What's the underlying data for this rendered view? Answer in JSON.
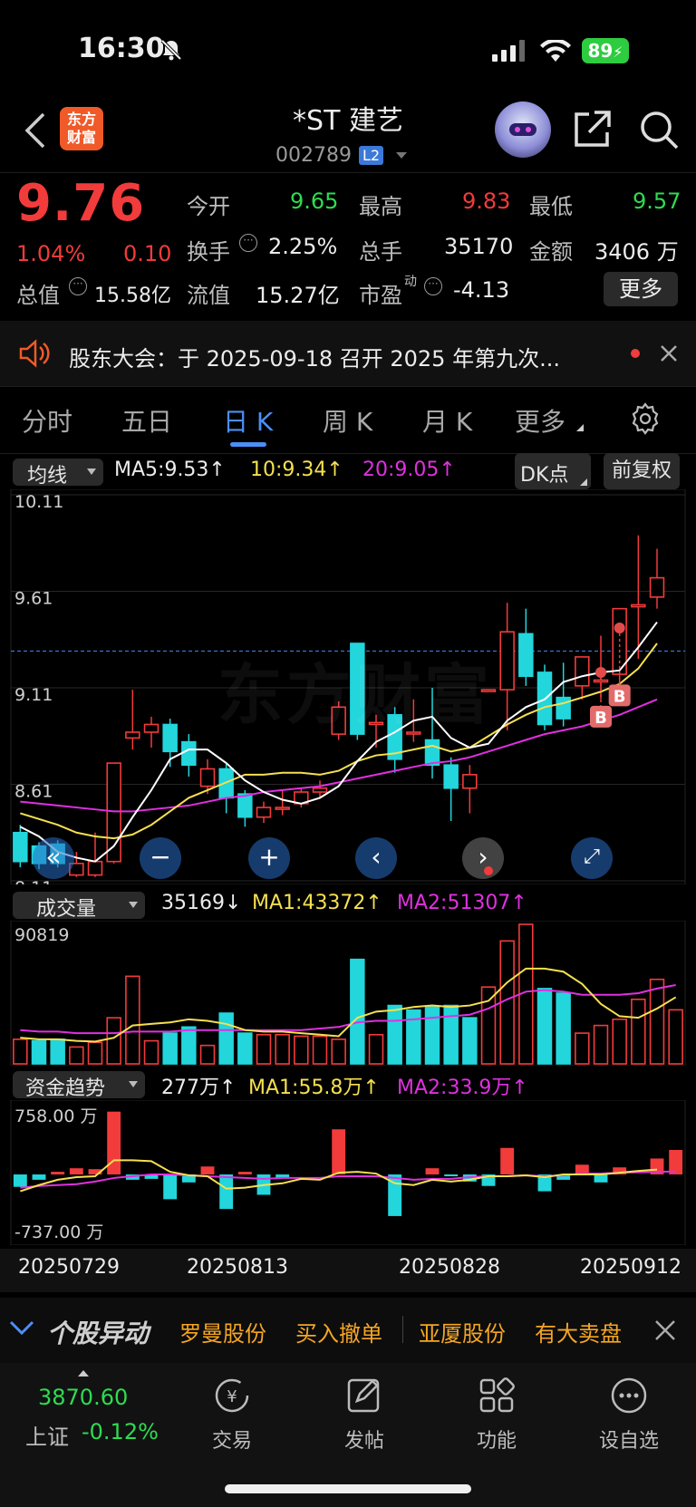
{
  "status_bar": {
    "time": "16:30",
    "battery": "89"
  },
  "header": {
    "logo_text": "东方财富",
    "stock_name": "*ST 建艺",
    "stock_code": "002789",
    "level_badge": "L2"
  },
  "quote": {
    "price": "9.76",
    "change_pct": "1.04%",
    "change": "0.10",
    "open_label": "今开",
    "open": "9.65",
    "high_label": "最高",
    "high": "9.83",
    "low_label": "最低",
    "low": "9.57",
    "turnover_label": "换手",
    "turnover": "2.25%",
    "volume_label": "总手",
    "volume": "35170",
    "amount_label": "金额",
    "amount": "3406 万",
    "mktcap_label": "总值",
    "mktcap": "15.58亿",
    "float_label": "流值",
    "float_cap": "15.27亿",
    "pe_label": "市盈",
    "pe_sup": "动",
    "pe": "-4.13",
    "more_button": "更多"
  },
  "notice": {
    "text": "股东大会：于 2025-09-18 召开 2025 年第九次..."
  },
  "tabs": [
    {
      "label": "分时"
    },
    {
      "label": "五日"
    },
    {
      "label": "日 K"
    },
    {
      "label": "周 K"
    },
    {
      "label": "月 K"
    },
    {
      "label": "更多"
    }
  ],
  "ma_bar": {
    "selector": "均线",
    "ma5": "MA5:9.53↑",
    "ma10": "10:9.34↑",
    "ma20": "20:9.05↑",
    "dk_button": "DK点",
    "adjust_button": "前复权"
  },
  "price_axis": [
    "10.11",
    "9.61",
    "9.11",
    "8.61",
    "8.11"
  ],
  "volume_bar": {
    "selector": "成交量",
    "value": "35169↓",
    "ma1": "MA1:43372↑",
    "ma2": "MA2:51307↑",
    "max_label": "90819"
  },
  "fund_bar": {
    "selector": "资金趋势",
    "value": "277万↑",
    "ma1": "MA1:55.8万↑",
    "ma2": "MA2:33.9万↑",
    "max_label": "758.00 万",
    "min_label": "-737.00 万"
  },
  "dates": [
    "20250729",
    "20250813",
    "20250828",
    "20250912"
  ],
  "signal_mark": "B",
  "watermark": "东方财富",
  "ticker_bar": {
    "title": "个股异动",
    "items": [
      "罗曼股份",
      "买入撤单",
      "亚厦股份",
      "有大卖盘"
    ]
  },
  "index_info": {
    "value": "3870.60",
    "name": "上证",
    "change": "-0.12%"
  },
  "bottom_nav": [
    {
      "label": "交易"
    },
    {
      "label": "发帖"
    },
    {
      "label": "功能"
    },
    {
      "label": "设自选"
    }
  ],
  "colors": {
    "up": "#f23b3b",
    "down": "#22d6dc",
    "ma5": "#ffffff",
    "ma10": "#f5e050",
    "ma20": "#e030e0",
    "accent": "#4b8ff6"
  },
  "chart_data": {
    "type": "candlestick",
    "y_range": [
      8.11,
      10.11
    ],
    "ref_price": 9.3,
    "candles": [
      {
        "o": 8.36,
        "c": 8.21,
        "h": 8.4,
        "l": 8.18
      },
      {
        "o": 8.29,
        "c": 8.2,
        "h": 8.31,
        "l": 8.17
      },
      {
        "o": 8.3,
        "c": 8.2,
        "h": 8.32,
        "l": 8.18
      },
      {
        "o": 8.14,
        "c": 8.2,
        "h": 8.26,
        "l": 8.13
      },
      {
        "o": 8.14,
        "c": 8.21,
        "h": 8.36,
        "l": 8.13
      },
      {
        "o": 8.21,
        "c": 8.72,
        "h": 8.72,
        "l": 8.2
      },
      {
        "o": 8.85,
        "c": 8.88,
        "h": 9.1,
        "l": 8.79
      },
      {
        "o": 8.88,
        "c": 8.92,
        "h": 8.96,
        "l": 8.8
      },
      {
        "o": 8.92,
        "c": 8.78,
        "h": 8.95,
        "l": 8.7
      },
      {
        "o": 8.83,
        "c": 8.71,
        "h": 8.87,
        "l": 8.65
      },
      {
        "o": 8.6,
        "c": 8.69,
        "h": 8.74,
        "l": 8.56
      },
      {
        "o": 8.69,
        "c": 8.54,
        "h": 8.72,
        "l": 8.46
      },
      {
        "o": 8.56,
        "c": 8.44,
        "h": 8.58,
        "l": 8.39
      },
      {
        "o": 8.44,
        "c": 8.49,
        "h": 8.52,
        "l": 8.41
      },
      {
        "o": 8.49,
        "c": 8.49,
        "h": 8.58,
        "l": 8.45
      },
      {
        "o": 8.51,
        "c": 8.57,
        "h": 8.59,
        "l": 8.49
      },
      {
        "o": 8.57,
        "c": 8.59,
        "h": 8.63,
        "l": 8.54
      },
      {
        "o": 8.87,
        "c": 9.01,
        "h": 9.04,
        "l": 8.84
      },
      {
        "o": 9.34,
        "c": 8.87,
        "h": 9.34,
        "l": 8.84
      },
      {
        "o": 8.93,
        "c": 8.93,
        "h": 8.97,
        "l": 8.8
      },
      {
        "o": 8.97,
        "c": 8.74,
        "h": 9.01,
        "l": 8.67
      },
      {
        "o": 8.88,
        "c": 8.88,
        "h": 9.05,
        "l": 8.83
      },
      {
        "o": 8.84,
        "c": 8.71,
        "h": 9.11,
        "l": 8.64
      },
      {
        "o": 8.71,
        "c": 8.59,
        "h": 8.75,
        "l": 8.42
      },
      {
        "o": 8.59,
        "c": 8.66,
        "h": 8.71,
        "l": 8.46
      },
      {
        "o": 9.1,
        "c": 9.1,
        "h": 9.1,
        "l": 9.1
      },
      {
        "o": 9.1,
        "c": 9.4,
        "h": 9.55,
        "l": 8.89
      },
      {
        "o": 9.39,
        "c": 9.17,
        "h": 9.52,
        "l": 9.12
      },
      {
        "o": 9.19,
        "c": 8.92,
        "h": 9.23,
        "l": 8.89
      },
      {
        "o": 9.06,
        "c": 8.95,
        "h": 9.24,
        "l": 8.91
      },
      {
        "o": 9.12,
        "c": 9.27,
        "h": 9.27,
        "l": 9.05
      },
      {
        "o": 9.15,
        "c": 9.15,
        "h": 9.38,
        "l": 9.05
      },
      {
        "o": 9.18,
        "c": 9.52,
        "h": 9.52,
        "l": 9.1
      },
      {
        "o": 9.53,
        "c": 9.54,
        "h": 9.9,
        "l": 9.26
      },
      {
        "o": 9.58,
        "c": 9.68,
        "h": 9.83,
        "l": 9.52
      }
    ],
    "ma5": [
      8.39,
      8.34,
      8.26,
      8.23,
      8.21,
      8.29,
      8.44,
      8.58,
      8.74,
      8.79,
      8.79,
      8.72,
      8.63,
      8.57,
      8.53,
      8.51,
      8.54,
      8.6,
      8.73,
      8.83,
      8.88,
      8.94,
      8.96,
      8.85,
      8.8,
      8.82,
      8.94,
      9.01,
      9.05,
      9.14,
      9.17,
      9.19,
      9.2,
      9.32,
      9.45
    ],
    "ma10": [
      8.46,
      8.43,
      8.4,
      8.36,
      8.34,
      8.33,
      8.35,
      8.4,
      8.47,
      8.54,
      8.58,
      8.62,
      8.66,
      8.66,
      8.67,
      8.67,
      8.66,
      8.68,
      8.73,
      8.76,
      8.77,
      8.79,
      8.81,
      8.78,
      8.8,
      8.86,
      8.92,
      8.97,
      9.01,
      9.03,
      9.06,
      9.09,
      9.13,
      9.21,
      9.34
    ],
    "ma20": [
      8.52,
      8.51,
      8.5,
      8.49,
      8.48,
      8.47,
      8.47,
      8.48,
      8.49,
      8.5,
      8.52,
      8.54,
      8.55,
      8.57,
      8.58,
      8.59,
      8.6,
      8.62,
      8.64,
      8.66,
      8.68,
      8.7,
      8.72,
      8.73,
      8.75,
      8.78,
      8.81,
      8.84,
      8.87,
      8.89,
      8.91,
      8.94,
      8.97,
      9.01,
      9.05
    ],
    "volume": {
      "y_max": 90819,
      "values": [
        16000,
        15000,
        16000,
        11000,
        14000,
        30000,
        57000,
        15000,
        20000,
        24000,
        12000,
        33000,
        20000,
        19000,
        19000,
        18000,
        18000,
        16000,
        68000,
        19000,
        38000,
        35000,
        37000,
        38000,
        30000,
        50000,
        80000,
        90819,
        49000,
        46000,
        20000,
        25000,
        29000,
        42000,
        55000,
        35169
      ],
      "up": [
        true,
        false,
        false,
        true,
        true,
        true,
        true,
        true,
        false,
        false,
        true,
        false,
        false,
        true,
        true,
        true,
        true,
        true,
        false,
        true,
        false,
        false,
        false,
        false,
        false,
        true,
        true,
        true,
        false,
        false,
        true,
        true,
        true,
        true,
        true,
        true
      ],
      "ma1": [
        17000,
        16000,
        16000,
        15000,
        14500,
        17000,
        25000,
        26000,
        27000,
        29000,
        28000,
        26000,
        22000,
        21000,
        21000,
        20000,
        19000,
        18000,
        30000,
        34000,
        35000,
        37000,
        38000,
        37000,
        38000,
        41000,
        53000,
        62000,
        62000,
        60000,
        52000,
        39000,
        31000,
        30000,
        36000,
        43372
      ],
      "ma2": [
        22000,
        21000,
        21000,
        20000,
        20000,
        20000,
        21000,
        21000,
        21000,
        22000,
        22000,
        22000,
        22000,
        22000,
        22000,
        22000,
        23000,
        24000,
        27000,
        28000,
        28000,
        29000,
        30000,
        31000,
        32000,
        36000,
        42000,
        47000,
        48000,
        47000,
        45000,
        45000,
        45000,
        46000,
        49000,
        51307
      ]
    },
    "fund_trend": {
      "y_range": [
        -737,
        758
      ],
      "values": [
        -140,
        -60,
        30,
        70,
        60,
        710,
        -60,
        -50,
        -280,
        -90,
        90,
        -390,
        30,
        -230,
        -40,
        0,
        0,
        510,
        0,
        0,
        -470,
        0,
        70,
        -20,
        -80,
        -130,
        300,
        0,
        -190,
        -60,
        110,
        -90,
        80,
        0,
        180,
        277
      ],
      "ma1": [
        -190,
        -120,
        -60,
        -30,
        -20,
        160,
        160,
        150,
        30,
        -10,
        -20,
        -160,
        -150,
        -120,
        -100,
        -50,
        -60,
        20,
        30,
        10,
        -100,
        -120,
        -60,
        -80,
        -60,
        -20,
        -20,
        -10,
        -30,
        0,
        0,
        0,
        20,
        40,
        55.8
      ],
      "ma2": [
        -150,
        -130,
        -120,
        -110,
        -80,
        -40,
        -20,
        0,
        0,
        -10,
        -20,
        -30,
        -40,
        -50,
        -40,
        -40,
        -40,
        -20,
        -20,
        -20,
        -40,
        -60,
        -50,
        -50,
        -30,
        -20,
        -20,
        -10,
        -20,
        -10,
        10,
        10,
        20,
        25,
        30,
        33.9
      ]
    }
  }
}
